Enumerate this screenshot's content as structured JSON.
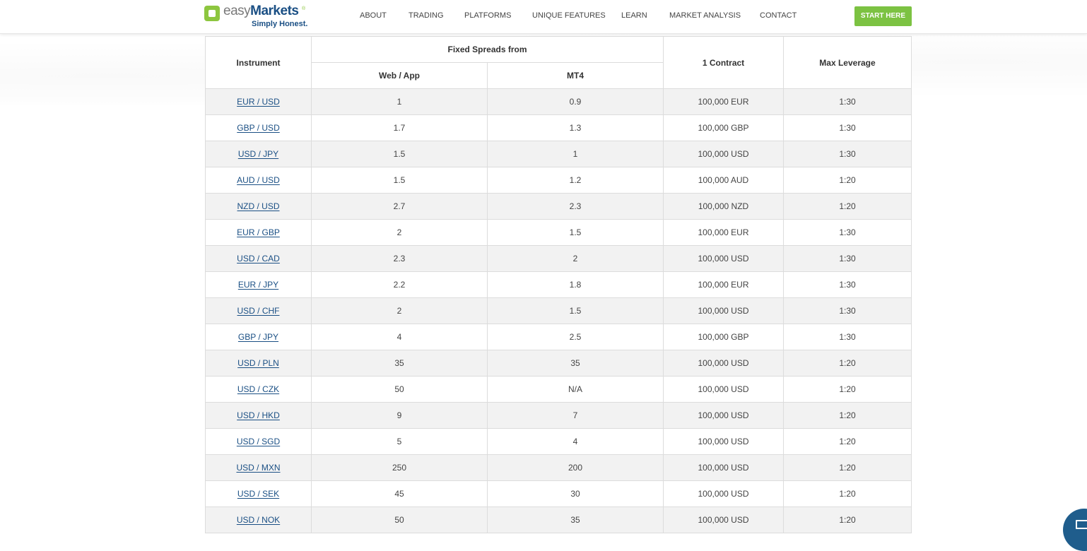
{
  "header": {
    "logo": {
      "easy": "easy",
      "markets": "Markets",
      "tm": "®",
      "tagline": "Simply Honest."
    },
    "nav": [
      "ABOUT",
      "TRADING",
      "PLATFORMS",
      "UNIQUE FEATURES",
      "LEARN",
      "MARKET ANALYSIS",
      "CONTACT"
    ],
    "cta_label": "START HERE"
  },
  "table": {
    "headers": {
      "instrument": "Instrument",
      "fixed_spreads": "Fixed Spreads from",
      "web_app": "Web / App",
      "mt4": "MT4",
      "contract": "1 Contract",
      "leverage": "Max Leverage"
    },
    "rows": [
      {
        "instrument": "EUR / USD",
        "web": "1",
        "mt4": "0.9",
        "contract": "100,000 EUR",
        "leverage": "1:30"
      },
      {
        "instrument": "GBP / USD",
        "web": "1.7",
        "mt4": "1.3",
        "contract": "100,000 GBP",
        "leverage": "1:30"
      },
      {
        "instrument": "USD / JPY",
        "web": "1.5",
        "mt4": "1",
        "contract": "100,000 USD",
        "leverage": "1:30"
      },
      {
        "instrument": "AUD / USD",
        "web": "1.5",
        "mt4": "1.2",
        "contract": "100,000 AUD",
        "leverage": "1:20"
      },
      {
        "instrument": "NZD / USD",
        "web": "2.7",
        "mt4": "2.3",
        "contract": "100,000 NZD",
        "leverage": "1:20"
      },
      {
        "instrument": "EUR / GBP",
        "web": "2",
        "mt4": "1.5",
        "contract": "100,000 EUR",
        "leverage": "1:30"
      },
      {
        "instrument": "USD / CAD",
        "web": "2.3",
        "mt4": "2",
        "contract": "100,000 USD",
        "leverage": "1:30"
      },
      {
        "instrument": "EUR / JPY",
        "web": "2.2",
        "mt4": "1.8",
        "contract": "100,000 EUR",
        "leverage": "1:30"
      },
      {
        "instrument": "USD / CHF",
        "web": "2",
        "mt4": "1.5",
        "contract": "100,000 USD",
        "leverage": "1:30"
      },
      {
        "instrument": "GBP / JPY",
        "web": "4",
        "mt4": "2.5",
        "contract": "100,000 GBP",
        "leverage": "1:30"
      },
      {
        "instrument": "USD / PLN",
        "web": "35",
        "mt4": "35",
        "contract": "100,000 USD",
        "leverage": "1:20"
      },
      {
        "instrument": "USD / CZK",
        "web": "50",
        "mt4": "N/A",
        "contract": "100,000 USD",
        "leverage": "1:20"
      },
      {
        "instrument": "USD / HKD",
        "web": "9",
        "mt4": "7",
        "contract": "100,000 USD",
        "leverage": "1:20"
      },
      {
        "instrument": "USD / SGD",
        "web": "5",
        "mt4": "4",
        "contract": "100,000 USD",
        "leverage": "1:20"
      },
      {
        "instrument": "USD / MXN",
        "web": "250",
        "mt4": "200",
        "contract": "100,000 USD",
        "leverage": "1:20"
      },
      {
        "instrument": "USD / SEK",
        "web": "45",
        "mt4": "30",
        "contract": "100,000 USD",
        "leverage": "1:20"
      },
      {
        "instrument": "USD / NOK",
        "web": "50",
        "mt4": "35",
        "contract": "100,000 USD",
        "leverage": "1:20"
      }
    ]
  },
  "chat_icon": "envelope-icon",
  "colors": {
    "brand_green": "#7cc242",
    "brand_blue": "#1a4f84",
    "row_stripe": "#f2f2f2"
  }
}
